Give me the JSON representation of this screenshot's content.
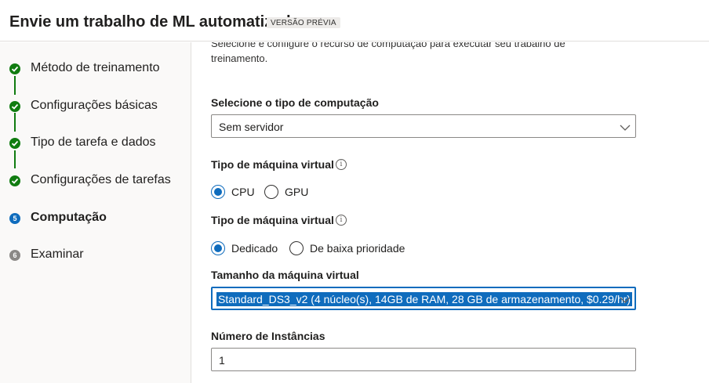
{
  "header": {
    "title": "Envie um trabalho de ML automatizado",
    "badge": "VERSÃO PRÉVIA"
  },
  "steps": [
    {
      "label": "Método de treinamento",
      "state": "done"
    },
    {
      "label": "Configurações básicas",
      "state": "done"
    },
    {
      "label": "Tipo de tarefa e dados",
      "state": "done"
    },
    {
      "label": "Configurações de tarefas",
      "state": "done"
    },
    {
      "label": "Computação",
      "state": "active",
      "number": "5"
    },
    {
      "label": "Examinar",
      "state": "pending",
      "number": "6"
    }
  ],
  "main": {
    "intro": "Selecione e configure o recurso de computação para executar seu trabalho de treinamento.",
    "compute_type": {
      "label": "Selecione o tipo de computação",
      "value": "Sem servidor"
    },
    "vm_type": {
      "label": "Tipo de máquina virtual",
      "options": [
        "CPU",
        "GPU"
      ],
      "selected": "CPU"
    },
    "vm_priority": {
      "label": "Tipo de máquina virtual",
      "options": [
        "Dedicado",
        "De baixa prioridade"
      ],
      "selected": "Dedicado"
    },
    "vm_size": {
      "label": "Tamanho da máquina virtual",
      "value": "Standard_DS3_v2 (4 núcleo(s), 14GB de RAM, 28 GB de armazenamento, $0.29/hr)"
    },
    "instances": {
      "label": "Número de Instâncias",
      "value": "1"
    }
  },
  "icons": {
    "info": "info-icon",
    "chevron": "chevron-down-icon",
    "check": "checkmark-icon"
  },
  "colors": {
    "accent": "#0f6cbd",
    "success": "#107c10",
    "pending": "#8a8886"
  }
}
